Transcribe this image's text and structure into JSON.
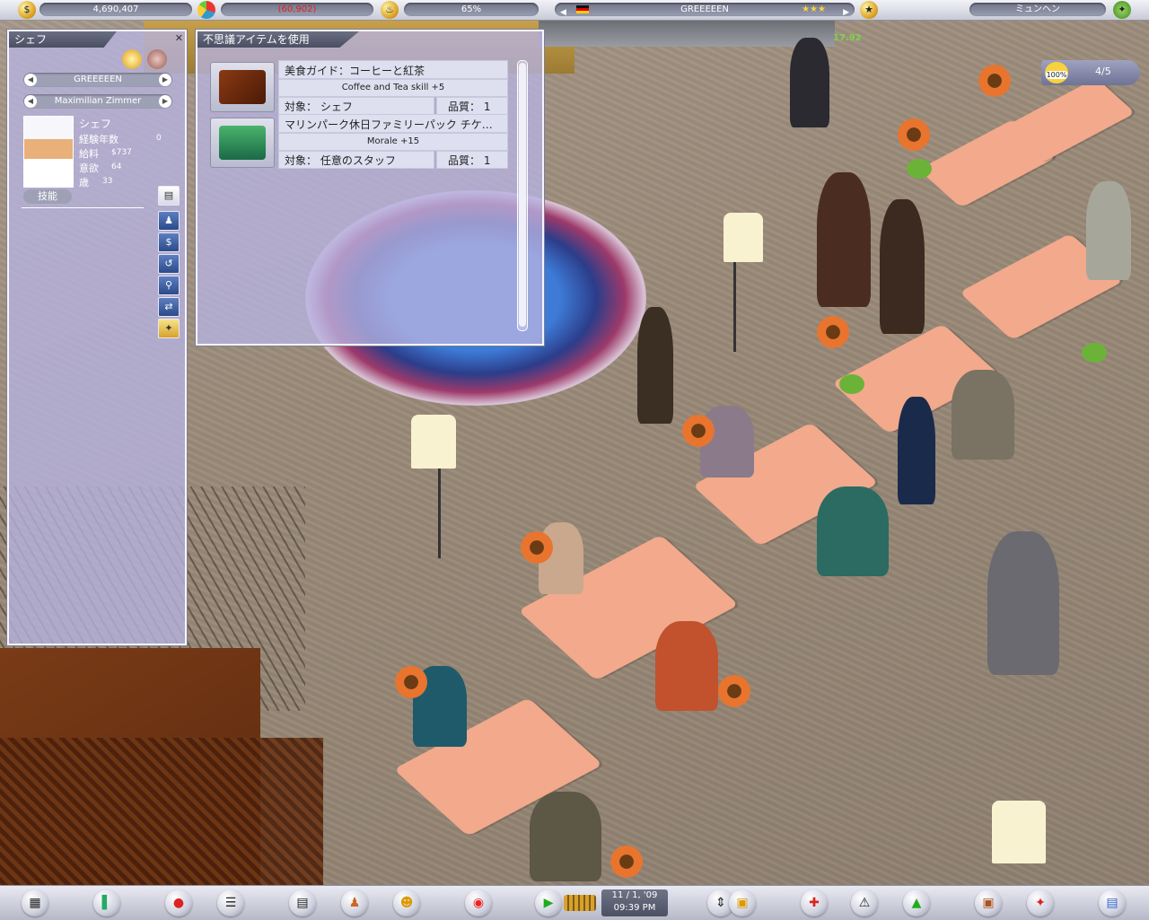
{
  "topbar": {
    "money": "4,690,407",
    "profit": "(60,902)",
    "percent": "65%",
    "restaurant": "GREEEEEN",
    "city": "ミュンヘン",
    "stars": "★★★",
    "icons": [
      "coin-icon",
      "pie-chart-icon",
      "chef-hat-icon",
      "flag-icon",
      "shield-icon",
      "compass-icon"
    ]
  },
  "scene": {
    "money_float": "17.92",
    "guest_level": "100%",
    "guest_count": "4/5"
  },
  "chef_panel": {
    "title": "シェフ",
    "restaurant": "GREEEEEN",
    "name": "Maximilian Zimmer",
    "role": "シェフ",
    "stats": [
      {
        "label": "経験年数",
        "value": "0"
      },
      {
        "label": "給料",
        "value": "$737"
      },
      {
        "label": "意欲",
        "value": "64"
      },
      {
        "label": "歳",
        "value": "33"
      }
    ],
    "skill_button": "技能",
    "side_icons": [
      "document-icon",
      "hire-icon",
      "money-icon",
      "train-icon",
      "search-icon",
      "transfer-icon",
      "magic-wand-icon"
    ]
  },
  "item_panel": {
    "title": "不思議アイテムを使用",
    "items": [
      {
        "name": "美食ガイド：コーヒーと紅茶",
        "effect": "Coffee and Tea skill +5",
        "target": "対象： シェフ",
        "quality": "品質： 1",
        "icon": "book-icon"
      },
      {
        "name": "マリンパーク休日ファミリーパック チケ…",
        "effect": "Morale +15",
        "target": "対象： 任意のスタッフ",
        "quality": "品質： 1",
        "icon": "ticket-icon"
      }
    ]
  },
  "bottombar": {
    "date": "11 / 1, '09",
    "time": "09:39 PM",
    "buttons": [
      "map-icon",
      "stats-icon",
      "tomato-icon",
      "menu-icon",
      "calculator-icon",
      "staff-icon",
      "guests-icon",
      "idea-icon",
      "play-icon",
      "speed-icon",
      "build-icon",
      "add-icon",
      "construction-icon",
      "upgrade-icon",
      "decoration-icon",
      "compass-icon",
      "book-icon"
    ]
  }
}
